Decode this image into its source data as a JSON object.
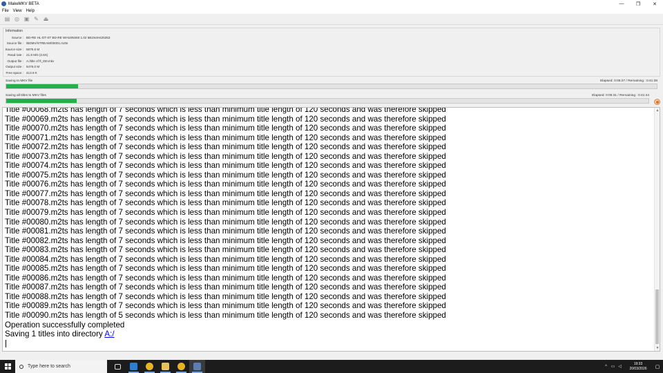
{
  "window": {
    "title": "MakeMKV BETA",
    "controls": {
      "minimize": "—",
      "maximize": "❐",
      "close": "✕"
    }
  },
  "menu": [
    "File",
    "View",
    "Help"
  ],
  "toolbar": {
    "icons": [
      "open-files-icon",
      "open-disc-icon",
      "backup-icon",
      "settings-icon",
      "eject-icon"
    ]
  },
  "info": {
    "legend": "Information",
    "rows": [
      {
        "label": "Source :",
        "value": "BD-RE HL-DT-ST BD-RE WH16NS60 1.02 5B1N4H425353"
      },
      {
        "label": "Source file :",
        "value": "/BDMV/STREAM/00001.m2ts"
      },
      {
        "label": "Source size :",
        "value": "5876.6 M"
      },
      {
        "label": "Read rate :",
        "value": "21.8 M/s (3.6X)"
      },
      {
        "label": "Output file :",
        "value": "A:/title of ft_t00.mkv"
      },
      {
        "label": "Output size :",
        "value": "5476.0 M"
      },
      {
        "label": "Free space :",
        "value": "413.9 K"
      }
    ]
  },
  "progress": {
    "current": {
      "label": "Saving to MKV file",
      "time": "Elapsed: 0:05:27 / Remaining : 0:41:38",
      "fraction": 0.11
    },
    "total": {
      "label": "Saving all titles to MKV files",
      "time": "Elapsed: 0:05:31 / Remaining : 0:41:44",
      "fraction": 0.11
    }
  },
  "log": {
    "lines": [
      "Title #00068.m2ts has length of 7 seconds which is less than minimum title length of 120 seconds and was therefore skipped",
      "Title #00069.m2ts has length of 7 seconds which is less than minimum title length of 120 seconds and was therefore skipped",
      "Title #00070.m2ts has length of 7 seconds which is less than minimum title length of 120 seconds and was therefore skipped",
      "Title #00071.m2ts has length of 7 seconds which is less than minimum title length of 120 seconds and was therefore skipped",
      "Title #00072.m2ts has length of 7 seconds which is less than minimum title length of 120 seconds and was therefore skipped",
      "Title #00073.m2ts has length of 7 seconds which is less than minimum title length of 120 seconds and was therefore skipped",
      "Title #00074.m2ts has length of 7 seconds which is less than minimum title length of 120 seconds and was therefore skipped",
      "Title #00075.m2ts has length of 7 seconds which is less than minimum title length of 120 seconds and was therefore skipped",
      "Title #00076.m2ts has length of 7 seconds which is less than minimum title length of 120 seconds and was therefore skipped",
      "Title #00077.m2ts has length of 7 seconds which is less than minimum title length of 120 seconds and was therefore skipped",
      "Title #00078.m2ts has length of 7 seconds which is less than minimum title length of 120 seconds and was therefore skipped",
      "Title #00079.m2ts has length of 7 seconds which is less than minimum title length of 120 seconds and was therefore skipped",
      "Title #00080.m2ts has length of 7 seconds which is less than minimum title length of 120 seconds and was therefore skipped",
      "Title #00081.m2ts has length of 7 seconds which is less than minimum title length of 120 seconds and was therefore skipped",
      "Title #00082.m2ts has length of 7 seconds which is less than minimum title length of 120 seconds and was therefore skipped",
      "Title #00083.m2ts has length of 7 seconds which is less than minimum title length of 120 seconds and was therefore skipped",
      "Title #00084.m2ts has length of 7 seconds which is less than minimum title length of 120 seconds and was therefore skipped",
      "Title #00085.m2ts has length of 7 seconds which is less than minimum title length of 120 seconds and was therefore skipped",
      "Title #00086.m2ts has length of 7 seconds which is less than minimum title length of 120 seconds and was therefore skipped",
      "Title #00087.m2ts has length of 7 seconds which is less than minimum title length of 120 seconds and was therefore skipped",
      "Title #00088.m2ts has length of 7 seconds which is less than minimum title length of 120 seconds and was therefore skipped",
      "Title #00089.m2ts has length of 7 seconds which is less than minimum title length of 120 seconds and was therefore skipped",
      "Title #00090.m2ts has length of 5 seconds which is less than minimum title length of 120 seconds and was therefore skipped",
      "Operation successfully completed"
    ],
    "last_prefix": "Saving 1 titles into directory ",
    "last_link": "A:/"
  },
  "taskbar": {
    "search_placeholder": "Type here to search",
    "apps": [
      {
        "icon": "task-view-icon",
        "color": "#1c1c1c"
      },
      {
        "icon": "edge-icon",
        "color": "#2d7dd2"
      },
      {
        "icon": "chrome-icon",
        "color": "#e6b422"
      },
      {
        "icon": "file-explorer-icon",
        "color": "#e8c05a"
      },
      {
        "icon": "chrome-icon",
        "color": "#e6b422"
      },
      {
        "icon": "makemkv-icon",
        "color": "#5b7fb5"
      }
    ],
    "time": "19:33",
    "date": "20/03/2026"
  },
  "colors": {
    "progress": "#21b04b",
    "link": "#0000ee",
    "taskbar": "#1c1c1c"
  }
}
